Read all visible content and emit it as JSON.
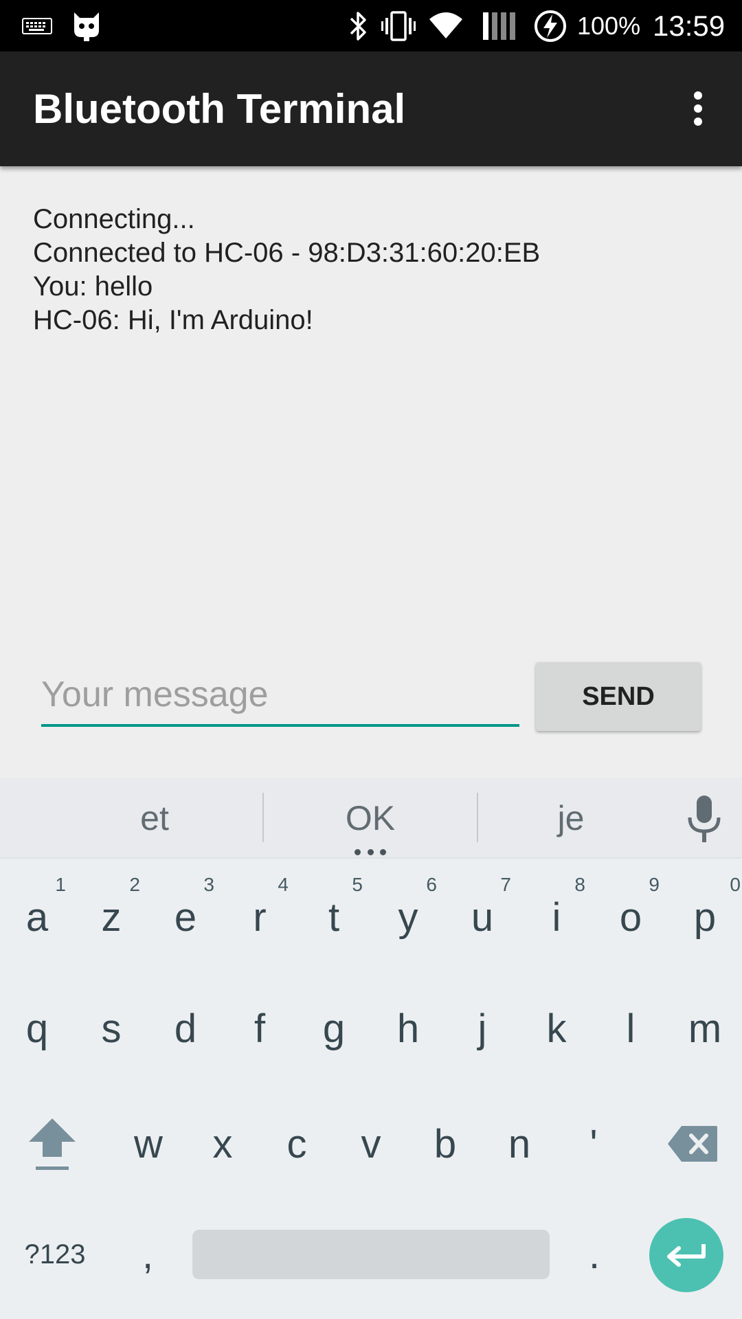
{
  "status_bar": {
    "icons": [
      "keyboard-icon",
      "cyanogen-icon",
      "bluetooth-icon",
      "vibrate-icon",
      "wifi-icon",
      "signal-icon",
      "battery-charging-icon"
    ],
    "battery": "100%",
    "time": "13:59"
  },
  "app_bar": {
    "title": "Bluetooth Terminal",
    "menu_icon": "more-vert-icon"
  },
  "messages": [
    "Connecting...",
    "Connected to HC-06 - 98:D3:31:60:20:EB",
    "You: hello",
    "HC-06: Hi, I'm Arduino!"
  ],
  "input": {
    "placeholder": "Your message",
    "value": ""
  },
  "send_button": {
    "label": "SEND"
  },
  "keyboard": {
    "suggestions": [
      "et",
      "OK",
      "je"
    ],
    "row1": [
      "a",
      "z",
      "e",
      "r",
      "t",
      "y",
      "u",
      "i",
      "o",
      "p"
    ],
    "row1_hints": [
      "1",
      "2",
      "3",
      "4",
      "5",
      "6",
      "7",
      "8",
      "9",
      "0"
    ],
    "row2": [
      "q",
      "s",
      "d",
      "f",
      "g",
      "h",
      "j",
      "k",
      "l",
      "m"
    ],
    "row3": [
      "w",
      "x",
      "c",
      "v",
      "b",
      "n",
      "'"
    ],
    "symbols_key": "?123",
    "comma_key": ",",
    "period_key": "."
  },
  "colors": {
    "accent": "#009688",
    "enter_key": "#4cc1b2",
    "app_bar": "#212121",
    "background": "#eeeeee"
  }
}
